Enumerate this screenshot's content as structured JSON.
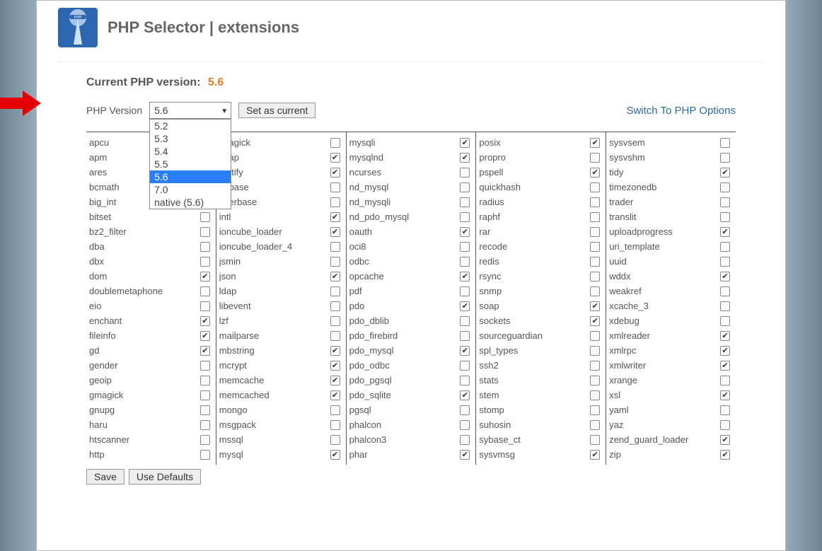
{
  "header": {
    "title": "PHP Selector | extensions"
  },
  "current_label": "Current PHP version:",
  "current_value": "5.6",
  "version_label": "PHP Version",
  "selected_version": "5.6",
  "set_current_btn": "Set as current",
  "switch_link": "Switch To PHP Options",
  "dropdown_options": [
    "5.2",
    "5.3",
    "5.4",
    "5.5",
    "5.6",
    "7.0",
    "native (5.6)"
  ],
  "save_btn": "Save",
  "defaults_btn": "Use Defaults",
  "columns": [
    [
      {
        "n": "apcu",
        "c": false
      },
      {
        "n": "apm",
        "c": false
      },
      {
        "n": "ares",
        "c": false
      },
      {
        "n": "bcmath",
        "c": false
      },
      {
        "n": "big_int",
        "c": false
      },
      {
        "n": "bitset",
        "c": false
      },
      {
        "n": "bz2_filter",
        "c": false
      },
      {
        "n": "dba",
        "c": false
      },
      {
        "n": "dbx",
        "c": false
      },
      {
        "n": "dom",
        "c": true
      },
      {
        "n": "doublemetaphone",
        "c": false
      },
      {
        "n": "eio",
        "c": false
      },
      {
        "n": "enchant",
        "c": true
      },
      {
        "n": "fileinfo",
        "c": true
      },
      {
        "n": "gd",
        "c": true
      },
      {
        "n": "gender",
        "c": false
      },
      {
        "n": "geoip",
        "c": false
      },
      {
        "n": "gmagick",
        "c": false
      },
      {
        "n": "gnupg",
        "c": false
      },
      {
        "n": "haru",
        "c": false
      },
      {
        "n": "htscanner",
        "c": false
      },
      {
        "n": "http",
        "c": false
      }
    ],
    [
      {
        "n": "imagick",
        "c": false
      },
      {
        "n": "imap",
        "c": true
      },
      {
        "n": "inotify",
        "c": true
      },
      {
        "n": "intbase",
        "c": false
      },
      {
        "n": "interbase",
        "c": false
      },
      {
        "n": "intl",
        "c": true
      },
      {
        "n": "ioncube_loader",
        "c": true
      },
      {
        "n": "ioncube_loader_4",
        "c": false
      },
      {
        "n": "jsmin",
        "c": false
      },
      {
        "n": "json",
        "c": true
      },
      {
        "n": "ldap",
        "c": false
      },
      {
        "n": "libevent",
        "c": false
      },
      {
        "n": "lzf",
        "c": false
      },
      {
        "n": "mailparse",
        "c": false
      },
      {
        "n": "mbstring",
        "c": true
      },
      {
        "n": "mcrypt",
        "c": true
      },
      {
        "n": "memcache",
        "c": true
      },
      {
        "n": "memcached",
        "c": true
      },
      {
        "n": "mongo",
        "c": false
      },
      {
        "n": "msgpack",
        "c": false
      },
      {
        "n": "mssql",
        "c": false
      },
      {
        "n": "mysql",
        "c": true
      }
    ],
    [
      {
        "n": "mysqli",
        "c": true
      },
      {
        "n": "mysqlnd",
        "c": true
      },
      {
        "n": "ncurses",
        "c": false
      },
      {
        "n": "nd_mysql",
        "c": false
      },
      {
        "n": "nd_mysqli",
        "c": false
      },
      {
        "n": "nd_pdo_mysql",
        "c": false
      },
      {
        "n": "oauth",
        "c": true
      },
      {
        "n": "oci8",
        "c": false
      },
      {
        "n": "odbc",
        "c": false
      },
      {
        "n": "opcache",
        "c": true
      },
      {
        "n": "pdf",
        "c": false
      },
      {
        "n": "pdo",
        "c": true
      },
      {
        "n": "pdo_dblib",
        "c": false
      },
      {
        "n": "pdo_firebird",
        "c": false
      },
      {
        "n": "pdo_mysql",
        "c": true
      },
      {
        "n": "pdo_odbc",
        "c": false
      },
      {
        "n": "pdo_pgsql",
        "c": false
      },
      {
        "n": "pdo_sqlite",
        "c": true
      },
      {
        "n": "pgsql",
        "c": false
      },
      {
        "n": "phalcon",
        "c": false
      },
      {
        "n": "phalcon3",
        "c": false
      },
      {
        "n": "phar",
        "c": true
      }
    ],
    [
      {
        "n": "posix",
        "c": true
      },
      {
        "n": "propro",
        "c": false
      },
      {
        "n": "pspell",
        "c": true
      },
      {
        "n": "quickhash",
        "c": false
      },
      {
        "n": "radius",
        "c": false
      },
      {
        "n": "raphf",
        "c": false
      },
      {
        "n": "rar",
        "c": false
      },
      {
        "n": "recode",
        "c": false
      },
      {
        "n": "redis",
        "c": false
      },
      {
        "n": "rsync",
        "c": false
      },
      {
        "n": "snmp",
        "c": false
      },
      {
        "n": "soap",
        "c": true
      },
      {
        "n": "sockets",
        "c": true
      },
      {
        "n": "sourceguardian",
        "c": false
      },
      {
        "n": "spl_types",
        "c": false
      },
      {
        "n": "ssh2",
        "c": false
      },
      {
        "n": "stats",
        "c": false
      },
      {
        "n": "stem",
        "c": false
      },
      {
        "n": "stomp",
        "c": false
      },
      {
        "n": "suhosin",
        "c": false
      },
      {
        "n": "sybase_ct",
        "c": false
      },
      {
        "n": "sysvmsg",
        "c": true
      }
    ],
    [
      {
        "n": "sysvsem",
        "c": false
      },
      {
        "n": "sysvshm",
        "c": false
      },
      {
        "n": "tidy",
        "c": true
      },
      {
        "n": "timezonedb",
        "c": false
      },
      {
        "n": "trader",
        "c": false
      },
      {
        "n": "translit",
        "c": false
      },
      {
        "n": "uploadprogress",
        "c": true
      },
      {
        "n": "uri_template",
        "c": false
      },
      {
        "n": "uuid",
        "c": false
      },
      {
        "n": "wddx",
        "c": true
      },
      {
        "n": "weakref",
        "c": false
      },
      {
        "n": "xcache_3",
        "c": false
      },
      {
        "n": "xdebug",
        "c": false
      },
      {
        "n": "xmlreader",
        "c": true
      },
      {
        "n": "xmlrpc",
        "c": true
      },
      {
        "n": "xmlwriter",
        "c": true
      },
      {
        "n": "xrange",
        "c": false
      },
      {
        "n": "xsl",
        "c": true
      },
      {
        "n": "yaml",
        "c": false
      },
      {
        "n": "yaz",
        "c": false
      },
      {
        "n": "zend_guard_loader",
        "c": true
      },
      {
        "n": "zip",
        "c": true
      }
    ]
  ]
}
